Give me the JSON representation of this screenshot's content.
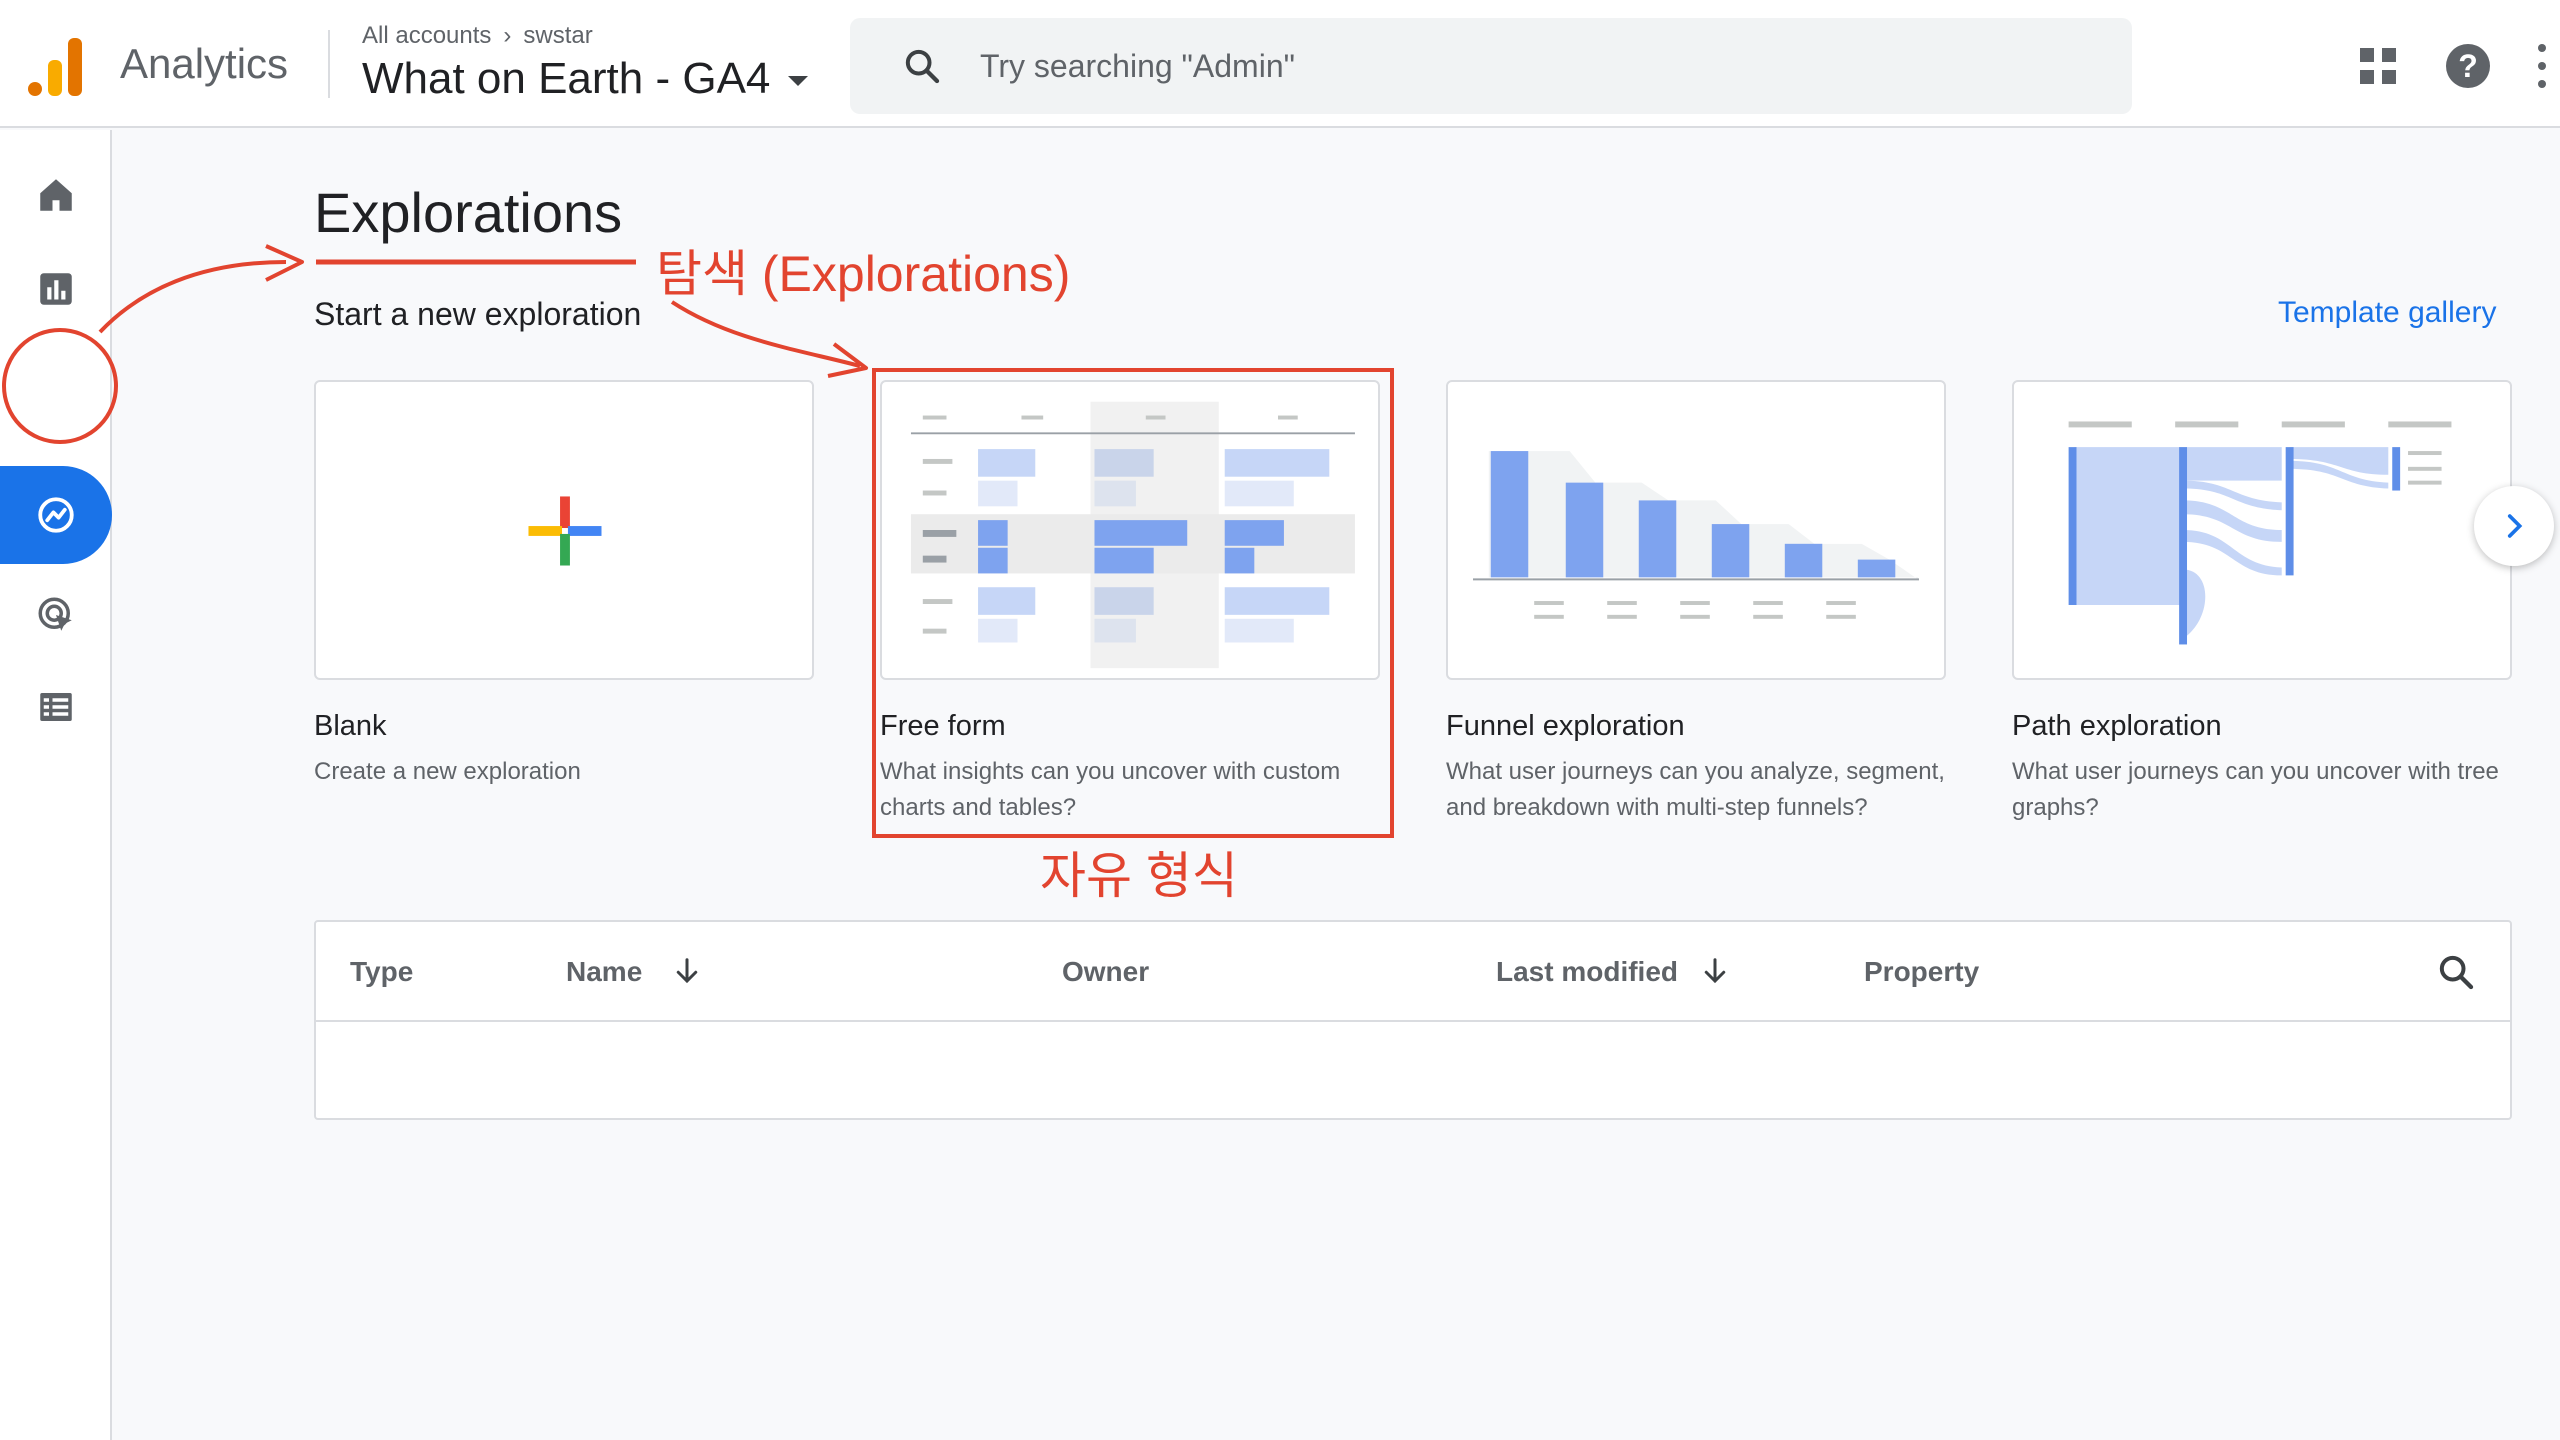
{
  "header": {
    "app_name": "Analytics",
    "breadcrumb": [
      "All accounts",
      "swstar"
    ],
    "breadcrumb_sep": "›",
    "property_name": "What on Earth - GA4",
    "search_placeholder": "Try searching \"Admin\"",
    "help_symbol": "?"
  },
  "sidebar": {
    "items": [
      "home-icon",
      "reports-icon",
      "explore-icon",
      "advertising-icon",
      "configure-icon"
    ],
    "active": "explore-icon",
    "settings": "gear-icon"
  },
  "main": {
    "title": "Explorations",
    "subtitle": "Start a new exploration",
    "template_gallery": "Template gallery",
    "cards": [
      {
        "title": "Blank",
        "desc": "Create a new exploration"
      },
      {
        "title": "Free form",
        "desc": "What insights can you uncover with custom charts and tables?"
      },
      {
        "title": "Funnel exploration",
        "desc": "What user journeys can you analyze, segment, and breakdown with multi-step funnels?"
      },
      {
        "title": "Path exploration",
        "desc": "What user journeys can you uncover with tree graphs?"
      }
    ]
  },
  "table": {
    "columns": [
      "Type",
      "Name",
      "Owner",
      "Last modified",
      "Property"
    ]
  },
  "annotations": {
    "explorations_label": "탐색 (Explorations)",
    "freeform_label": "자유 형식",
    "color": "#e2442f"
  },
  "colors": {
    "accent": "#1a73e8",
    "logo_orange": "#f9ab00",
    "logo_dark": "#e37400"
  }
}
